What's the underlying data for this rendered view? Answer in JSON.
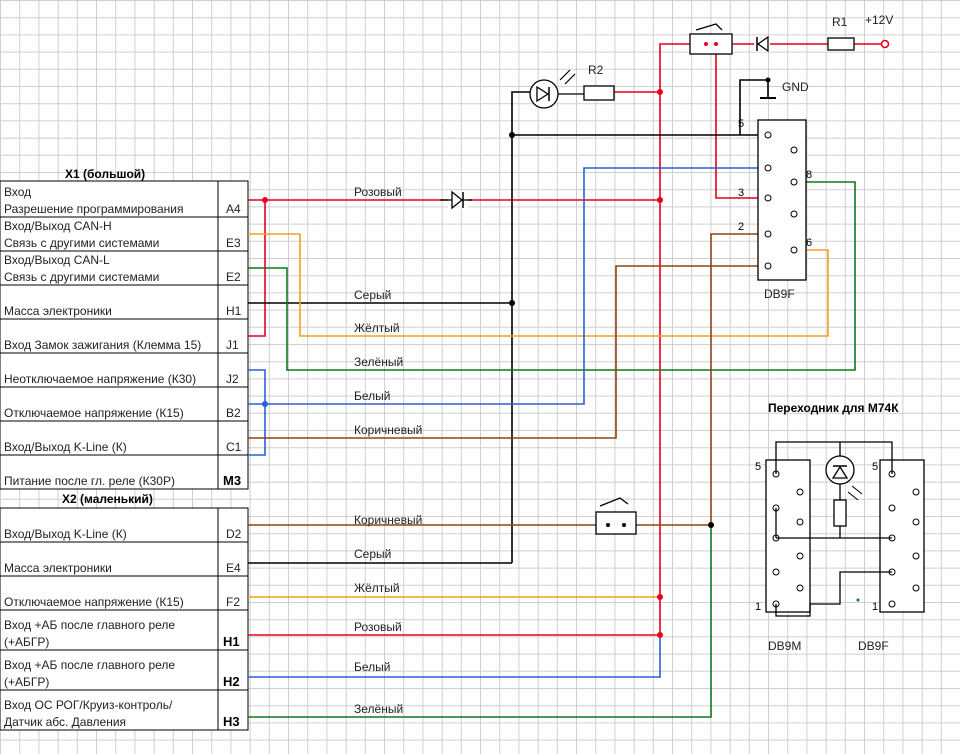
{
  "x1": {
    "title": "X1 (большой)",
    "rows": [
      {
        "lines": [
          "Вход",
          "Разрешение программирования"
        ],
        "pin": "A4",
        "bold": false
      },
      {
        "lines": [
          "Вход/Выход CAN-H",
          "Связь с другими системами"
        ],
        "pin": "E3",
        "bold": false
      },
      {
        "lines": [
          "Вход/Выход CAN-L",
          "Связь с другими системами"
        ],
        "pin": "E2",
        "bold": false
      },
      {
        "lines": [
          "Масса электроники"
        ],
        "pin": "H1",
        "bold": false
      },
      {
        "lines": [
          "Вход Замок зажигания (Клемма 15)"
        ],
        "pin": "J1",
        "bold": false
      },
      {
        "lines": [
          "Неотключаемое напряжение (К30)"
        ],
        "pin": "J2",
        "bold": false
      },
      {
        "lines": [
          "Отключаемое напряжение (К15)"
        ],
        "pin": "B2",
        "bold": false
      },
      {
        "lines": [
          "Вход/Выход K-Line (К)"
        ],
        "pin": "C1",
        "bold": false
      },
      {
        "lines": [
          "Питание после гл. реле (К30Р)"
        ],
        "pin": "M3",
        "bold": true
      }
    ]
  },
  "x2": {
    "title": "X2 (маленький)",
    "rows": [
      {
        "lines": [
          "Вход/Выход K-Line (К)"
        ],
        "pin": "D2",
        "bold": false
      },
      {
        "lines": [
          "Масса электроники"
        ],
        "pin": "E4",
        "bold": false
      },
      {
        "lines": [
          "Отключаемое напряжение (К15)"
        ],
        "pin": "F2",
        "bold": false
      },
      {
        "lines": [
          "Вход +АБ после главного реле",
          "(+АБГР)"
        ],
        "pin": "H1",
        "bold": true
      },
      {
        "lines": [
          "Вход +АБ после главного реле",
          "(+АБГР)"
        ],
        "pin": "H2",
        "bold": true
      },
      {
        "lines": [
          "Вход ОС РОГ/Круиз-контроль/",
          "Датчик абс. Давления"
        ],
        "pin": "H3",
        "bold": true
      }
    ]
  },
  "wires": {
    "pink1": "Розовый",
    "gray1": "Серый",
    "yellow1": "Жёлтый",
    "green1": "Зелёный",
    "white1": "Белый",
    "brown1": "Коричневый",
    "brown2": "Коричневый",
    "gray2": "Серый",
    "yellow2": "Жёлтый",
    "pink2": "Розовый",
    "white2": "Белый",
    "green2": "Зелёный"
  },
  "components": {
    "r1": "R1",
    "r2": "R2",
    "v12": "+12V",
    "gnd": "GND",
    "db9f_main": "DB9F",
    "pin5": "5",
    "pin3": "3",
    "pin8": "8",
    "pin2": "2",
    "pin6": "6"
  },
  "adapter": {
    "title": "Переходник для М74К",
    "left_label": "DB9M",
    "right_label": "DB9F",
    "l5": "5",
    "r5": "5",
    "l1": "1",
    "r1": "1"
  },
  "colors": {
    "red": "#e8001c",
    "blue": "#2b5fd9",
    "orange": "#f0a020",
    "green": "#0c7a18",
    "brown": "#8b4513",
    "black": "#000000",
    "grid": "#c8c8c8"
  }
}
